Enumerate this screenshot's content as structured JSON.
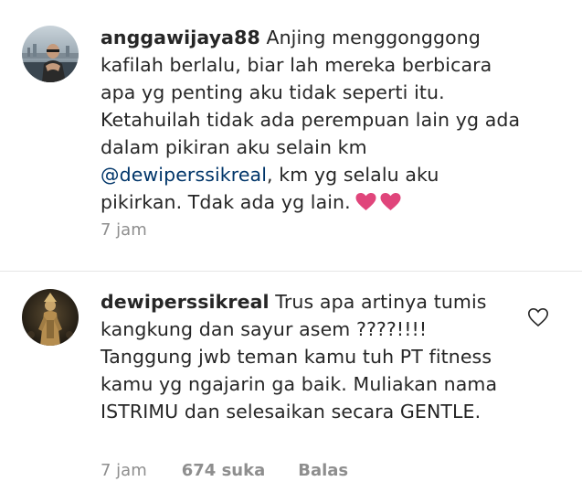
{
  "comments": [
    {
      "username": "anggawijaya88",
      "text_before": " Anjing menggonggong kafilah berlalu, biar lah mereka berbicara apa yg penting aku tidak seperti itu. Ketahuilah tidak ada perempuan lain yg ada dalam pikiran aku selain km ",
      "mention": "@dewiperssikreal",
      "text_after": ", km yg selalu aku pikirkan. Tdak ada yg lain.",
      "emoji": "heart-emoji-pink",
      "emoji_color": "#e0457b",
      "time": "7 jam"
    },
    {
      "username": "dewiperssikreal",
      "text": " Trus apa artinya tumis kangkung dan sayur asem ????!!!! Tanggung jwb teman kamu tuh PT fitness kamu yg ngajarin ga baik. Muliakan nama ISTRIMU dan selesaikan secara GENTLE.",
      "time": "7 jam",
      "likes": "674 suka",
      "reply_label": "Balas",
      "like_icon": "heart-outline-icon"
    }
  ],
  "colors": {
    "text": "#262626",
    "secondary": "#8e8e8e",
    "mention": "#003569",
    "divider": "#e6e6e6"
  }
}
